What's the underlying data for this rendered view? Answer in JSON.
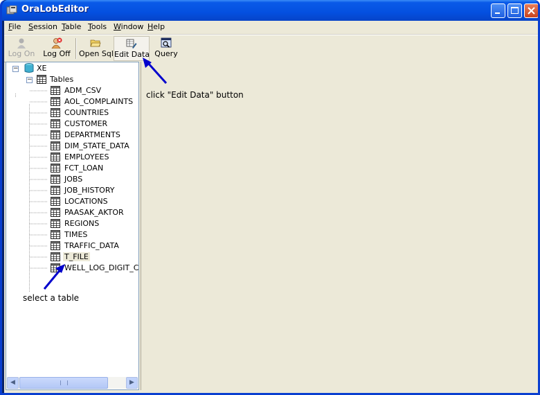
{
  "window": {
    "title": "OraLobEditor"
  },
  "menu": {
    "items": [
      {
        "key": "F",
        "rest": "ile"
      },
      {
        "key": "S",
        "rest": "ession"
      },
      {
        "key": "T",
        "rest": "able"
      },
      {
        "key": "T",
        "rest": "ools"
      },
      {
        "key": "W",
        "rest": "indow"
      },
      {
        "key": "H",
        "rest": "elp"
      }
    ]
  },
  "toolbar": {
    "log_on": "Log On",
    "log_off": "Log Off",
    "open_sql": "Open Sql",
    "edit_data": "Edit Data",
    "query": "Query"
  },
  "tree": {
    "root": "XE",
    "group": "Tables",
    "tables": [
      "ADM_CSV",
      "AOL_COMPLAINTS",
      "COUNTRIES",
      "CUSTOMER",
      "DEPARTMENTS",
      "DIM_STATE_DATA",
      "EMPLOYEES",
      "FCT_LOAN",
      "JOBS",
      "JOB_HISTORY",
      "LOCATIONS",
      "PAASAK_AKTOR",
      "REGIONS",
      "TIMES",
      "TRAFFIC_DATA",
      "T_FILE",
      "WELL_LOG_DIGIT_C"
    ],
    "selected": "T_FILE"
  },
  "annotations": {
    "edit_data_hint": "click \"Edit Data\" button",
    "select_table_hint": "select a table"
  },
  "colors": {
    "annotation_arrow": "#0000cc",
    "title_bar": "#0450e0"
  }
}
